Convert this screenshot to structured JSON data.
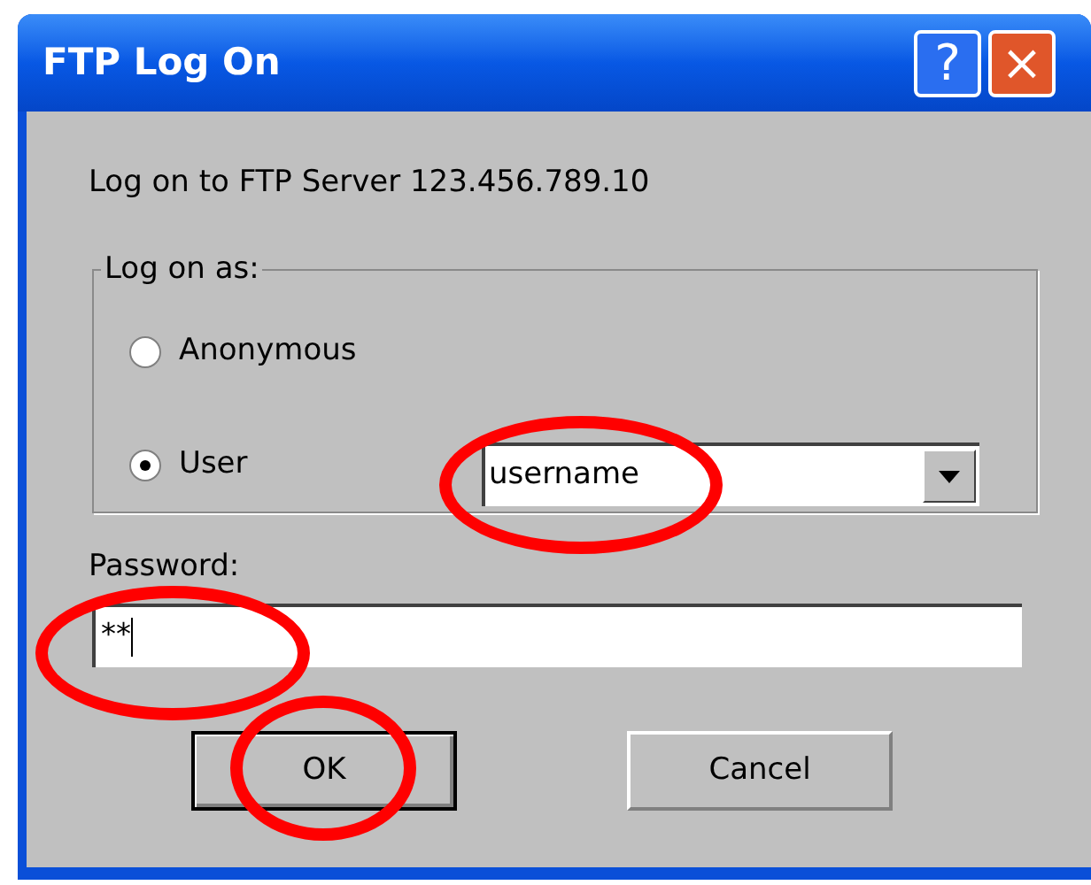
{
  "window": {
    "title": "FTP Log On",
    "buttons": [
      {
        "kind": "help",
        "label": "?"
      },
      {
        "kind": "close",
        "label": "×"
      }
    ]
  },
  "message": "Log on to FTP Server 123.456.789.10",
  "log_on_as": {
    "legend": "Log on as:",
    "options": [
      {
        "label": "Anonymous",
        "selected": false
      },
      {
        "label": "User",
        "selected": true
      }
    ],
    "user_field": {
      "value": "username",
      "highlighted": true
    }
  },
  "password": {
    "label": "Password:",
    "value": "**",
    "highlighted": true
  },
  "buttons": [
    {
      "label": "OK",
      "default": true,
      "highlighted": true
    },
    {
      "label": "Cancel",
      "default": false,
      "highlighted": false
    }
  ]
}
